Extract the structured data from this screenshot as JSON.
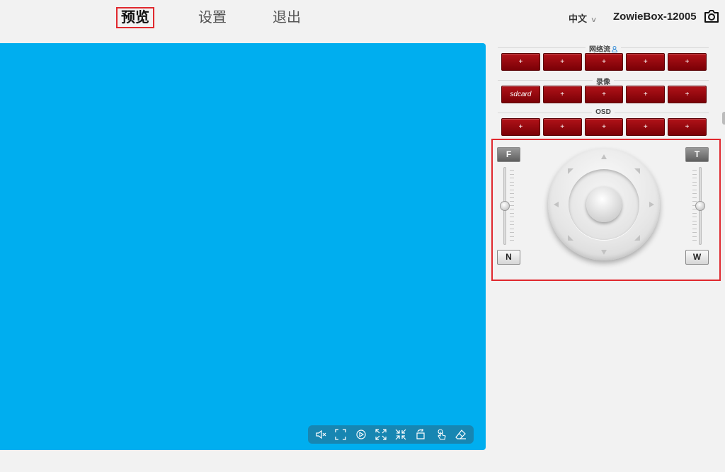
{
  "nav": {
    "tabs": [
      {
        "label": "预览"
      },
      {
        "label": "设置"
      },
      {
        "label": "退出"
      }
    ],
    "language": "中文",
    "device_name": "ZowieBox-12005"
  },
  "toolbar": {
    "icons": [
      "mute-icon",
      "fullscreen-icon",
      "zoom-area-icon",
      "expand-icon",
      "shrink-icon",
      "rotate-icon",
      "touch-icon",
      "eraser-icon"
    ]
  },
  "panel": {
    "stream_title": "网络流",
    "stream_buttons": [
      "+",
      "+",
      "+",
      "+",
      "+"
    ],
    "record_title": "录像",
    "record_buttons": [
      "sdcard",
      "+",
      "+",
      "+",
      "+"
    ],
    "osd_title": "OSD",
    "osd_buttons": [
      "+",
      "+",
      "+",
      "+",
      "+"
    ]
  },
  "ptz": {
    "focus_far": "F",
    "focus_near": "N",
    "zoom_tele": "T",
    "zoom_wide": "W",
    "focus_level": 0.5,
    "zoom_level": 0.5
  },
  "colors": {
    "video_bg": "#00aeef",
    "accent_red": "#e0282e",
    "button_red": "#8b0a0f"
  }
}
